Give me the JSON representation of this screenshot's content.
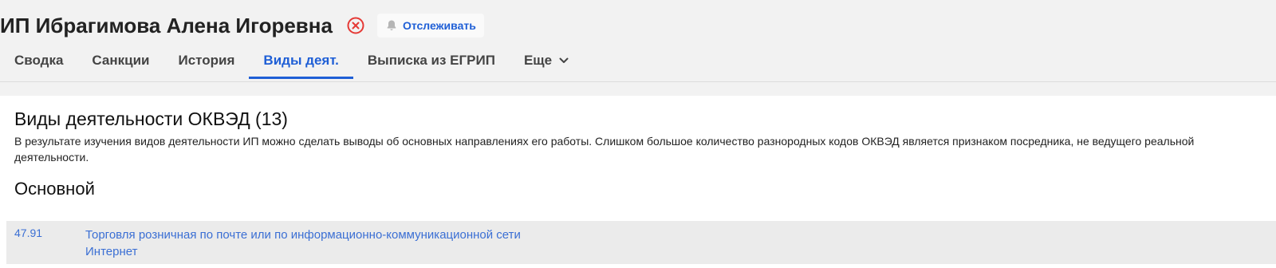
{
  "header": {
    "company_name": "ИП Ибрагимова Алена Игоревна",
    "status_icon": "close-circle-icon",
    "track_button": {
      "icon": "bell-icon",
      "label": "Отслеживать"
    }
  },
  "tabs": [
    {
      "label": "Сводка",
      "active": false
    },
    {
      "label": "Санкции",
      "active": false
    },
    {
      "label": "История",
      "active": false
    },
    {
      "label": "Виды деят.",
      "active": true
    },
    {
      "label": "Выписка из ЕГРИП",
      "active": false
    },
    {
      "label": "Еще",
      "active": false,
      "icon": "chevron-down-icon"
    }
  ],
  "main": {
    "title": "Виды деятельности ОКВЭД (13)",
    "description": "В результате изучения видов деятельности ИП можно сделать выводы об основных направлениях его работы. Слишком большое количество разнородных кодов ОКВЭД является признаком посредника, не ведущего реальной деятельности.",
    "primary_heading": "Основной",
    "primary_activity": {
      "code": "47.91",
      "name_line1": "Торговля розничная по почте или по информационно-коммуникационной сети",
      "name_line2": "Интернет"
    }
  },
  "colors": {
    "accent": "#1f5fd6",
    "link": "#3b6fd4",
    "danger": "#e53935"
  }
}
